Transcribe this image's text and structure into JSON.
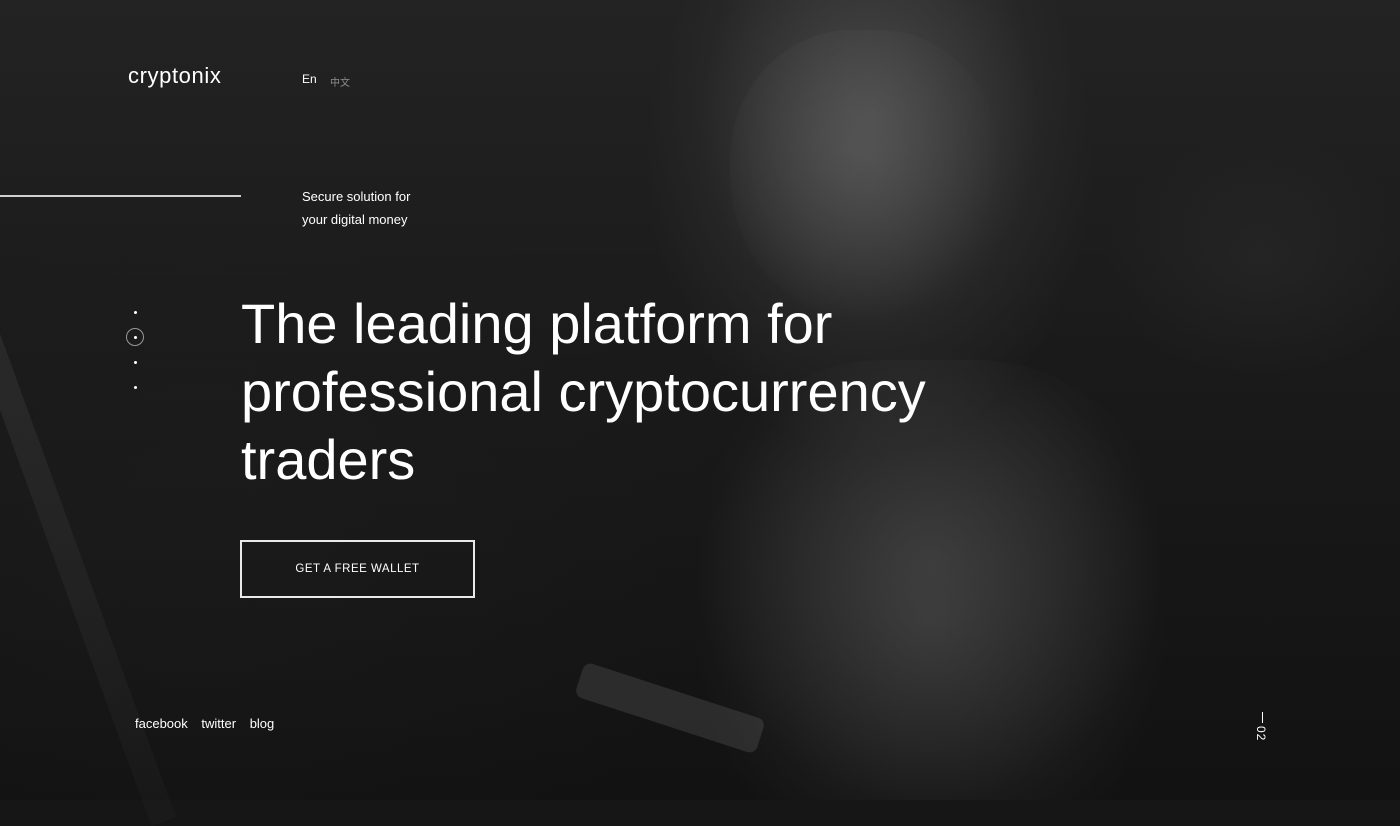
{
  "brand": {
    "logo": "cryptonix"
  },
  "languages": [
    {
      "label": "En",
      "active": true
    },
    {
      "label": "中文",
      "active": false
    }
  ],
  "tagline": {
    "line1": "Secure solution for",
    "line2": "your digital money"
  },
  "hero": {
    "line1": "The leading platform for",
    "line2": "professional cryptocurrency",
    "line3": "traders"
  },
  "cta": {
    "label": "GET A FREE WALLET"
  },
  "slider": {
    "total": 4,
    "active_index": 2
  },
  "social": {
    "facebook": "facebook",
    "twitter": "twitter",
    "blog": "blog"
  },
  "page_indicator": {
    "label": "02"
  },
  "colors": {
    "background": "#161616",
    "text": "#ffffff",
    "muted": "#8f8f8f"
  }
}
